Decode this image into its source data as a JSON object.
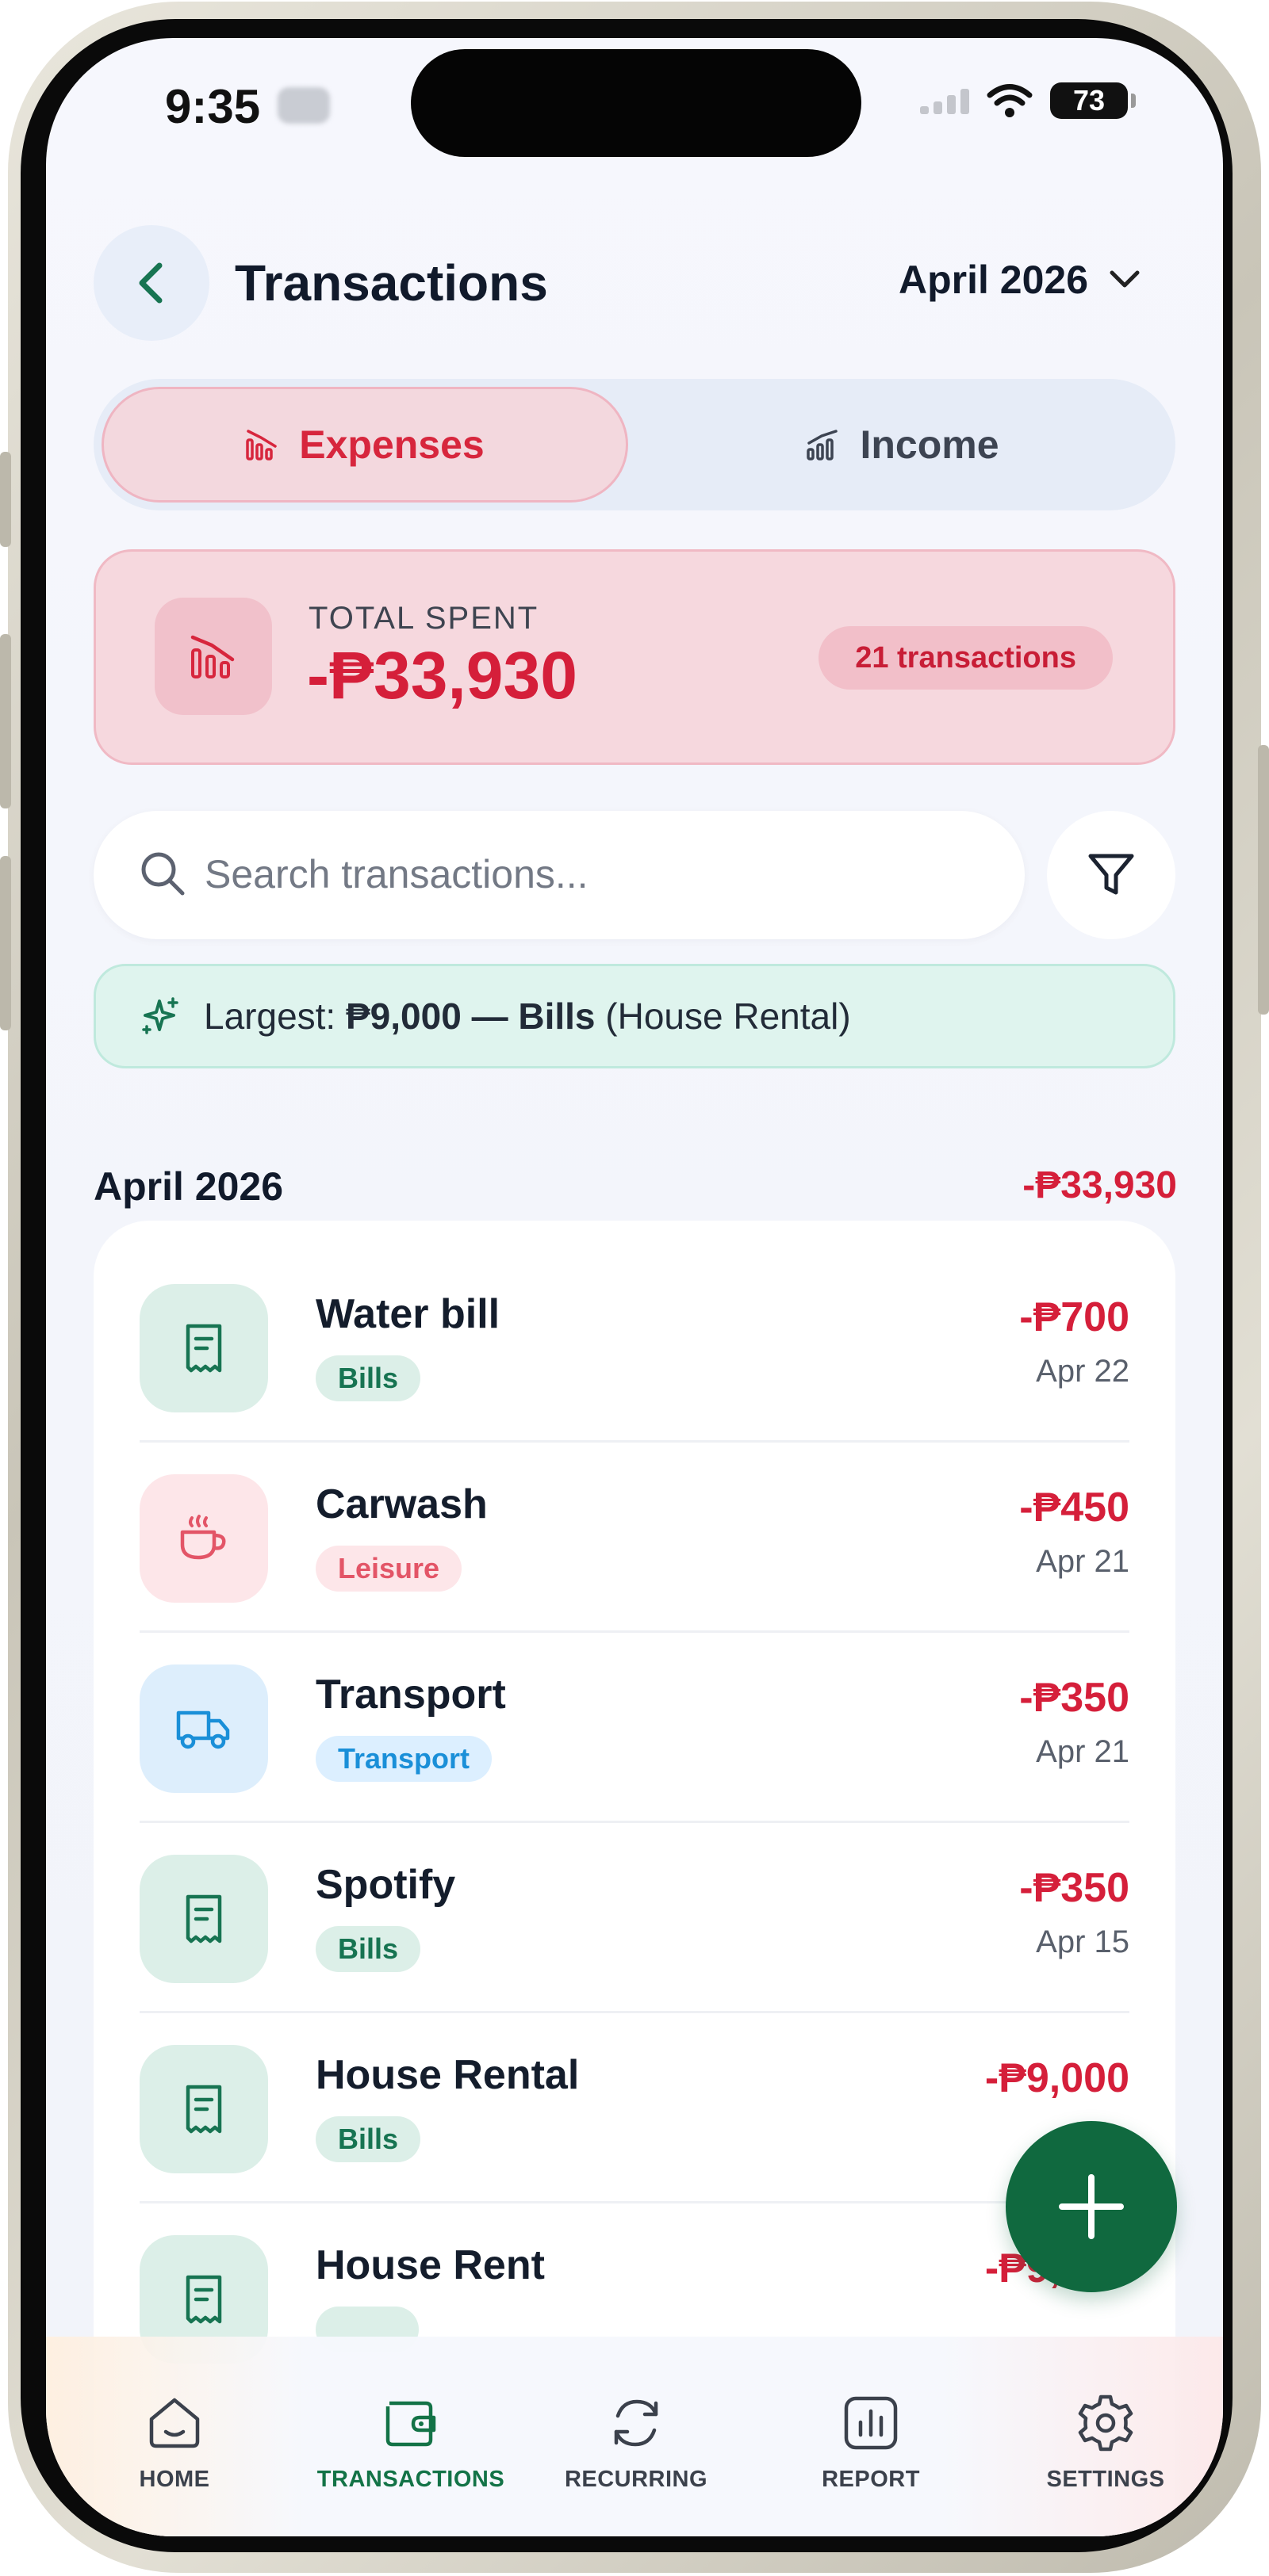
{
  "status_bar": {
    "time": "9:35",
    "battery": "73"
  },
  "header": {
    "title": "Transactions",
    "month": "April 2026"
  },
  "segments": {
    "expenses": "Expenses",
    "income": "Income"
  },
  "summary": {
    "label": "TOTAL SPENT",
    "value": "-₱33,930",
    "count": "21 transactions"
  },
  "search": {
    "placeholder": "Search transactions..."
  },
  "insight": {
    "prefix": "Largest: ",
    "highlight": "₱9,000 — Bills",
    "suffix": " (House Rental)"
  },
  "section": {
    "title": "April 2026",
    "total": "-₱33,930"
  },
  "transactions": [
    {
      "name": "Water bill",
      "category": "Bills",
      "amount": "-₱700",
      "date": "Apr 22"
    },
    {
      "name": "Carwash",
      "category": "Leisure",
      "amount": "-₱450",
      "date": "Apr 21"
    },
    {
      "name": "Transport",
      "category": "Transport",
      "amount": "-₱350",
      "date": "Apr 21"
    },
    {
      "name": "Spotify",
      "category": "Bills",
      "amount": "-₱350",
      "date": "Apr 15"
    },
    {
      "name": "House Rental",
      "category": "Bills",
      "amount": "-₱9,000",
      "date": ""
    },
    {
      "name": "House Rent",
      "category": "",
      "amount": "-₱9,000",
      "date": ""
    }
  ],
  "nav": [
    {
      "label": "HOME",
      "icon": "home-icon"
    },
    {
      "label": "TRANSACTIONS",
      "icon": "wallet-icon"
    },
    {
      "label": "RECURRING",
      "icon": "refresh-icon"
    },
    {
      "label": "REPORT",
      "icon": "chart-icon"
    },
    {
      "label": "SETTINGS",
      "icon": "gear-icon"
    }
  ],
  "colors": {
    "accent_green": "#10693f",
    "expense_red": "#d51f3a",
    "bills_tag": "#dcefe8",
    "leisure_tag": "#fde6e9",
    "transport_tag": "#dcefff"
  }
}
